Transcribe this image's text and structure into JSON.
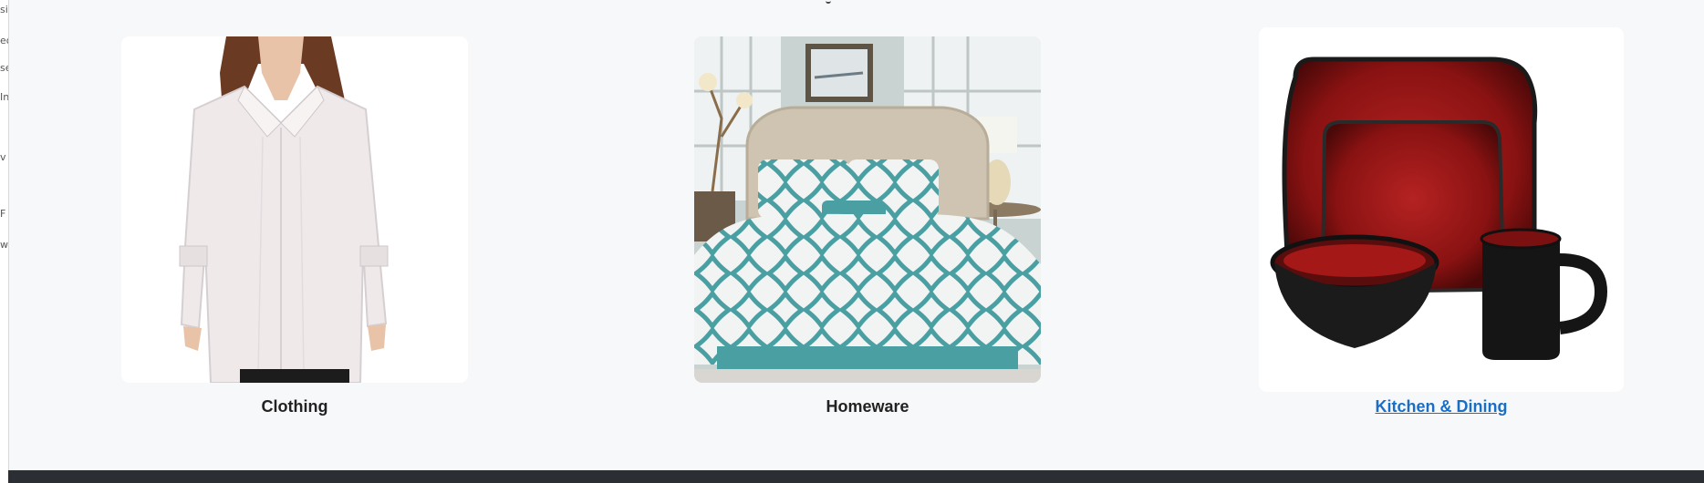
{
  "categories": [
    {
      "label": "Clothing",
      "image": "white-button-shirt-photo",
      "is_link": false
    },
    {
      "label": "Homeware",
      "image": "teal-bedding-set-photo",
      "is_link": false
    },
    {
      "label": "Kitchen & Dining",
      "image": "red-dinnerware-set-photo",
      "is_link": true
    }
  ],
  "colors": {
    "page_bg": "#f7f8fa",
    "link": "#1a6fc4",
    "footer": "#2b2f33",
    "teal": "#4a9fa3",
    "dish_red": "#8e1414"
  }
}
